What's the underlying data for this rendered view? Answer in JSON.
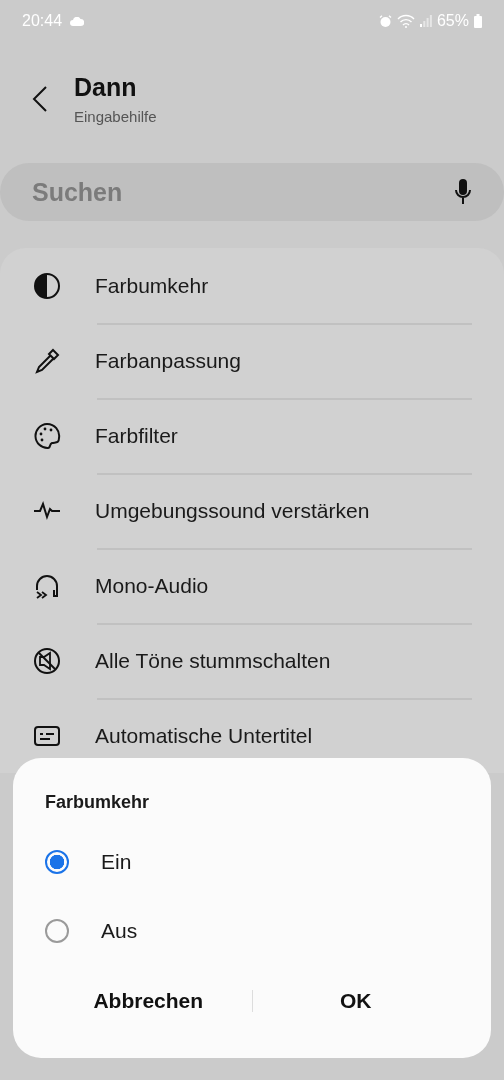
{
  "status_bar": {
    "time": "20:44",
    "battery": "65%"
  },
  "header": {
    "title": "Dann",
    "subtitle": "Eingabehilfe"
  },
  "search": {
    "placeholder": "Suchen"
  },
  "items": [
    {
      "label": "Farbumkehr"
    },
    {
      "label": "Farbanpassung"
    },
    {
      "label": "Farbfilter"
    },
    {
      "label": "Umgebungssound verstärken"
    },
    {
      "label": "Mono-Audio"
    },
    {
      "label": "Alle Töne stummschalten"
    },
    {
      "label": "Automatische Untertitel"
    }
  ],
  "dialog": {
    "title": "Farbumkehr",
    "options": [
      {
        "label": "Ein",
        "selected": true
      },
      {
        "label": "Aus",
        "selected": false
      }
    ],
    "buttons": [
      "Abbrechen",
      "OK"
    ]
  }
}
